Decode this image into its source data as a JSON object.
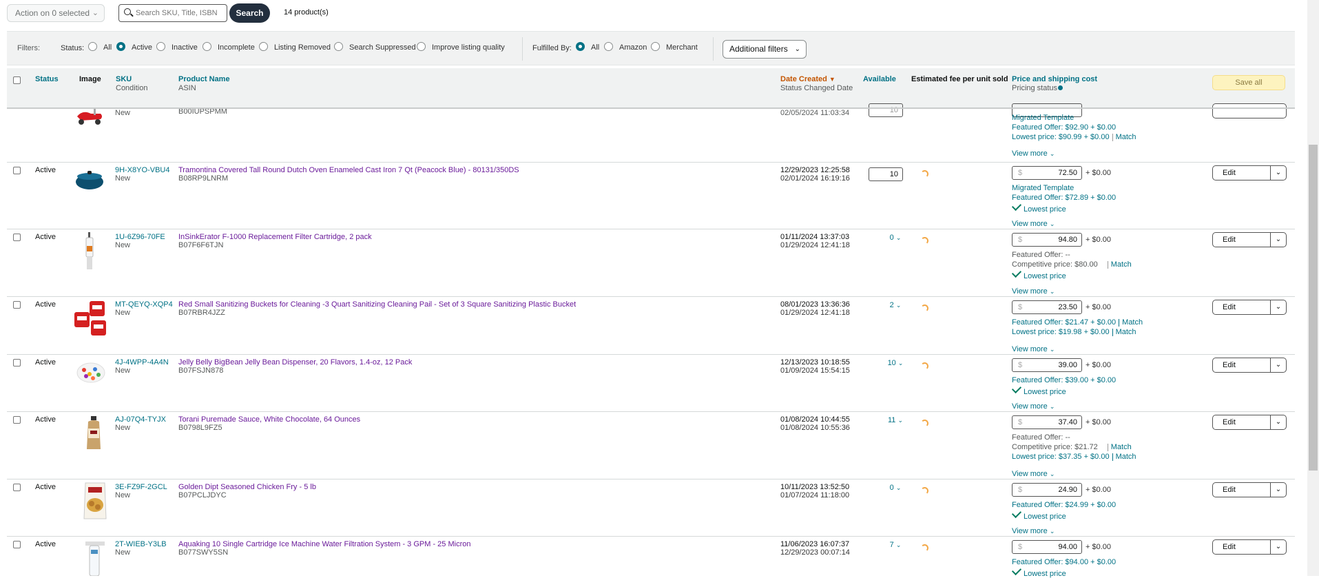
{
  "toolbar": {
    "action_label": "Action on 0 selected",
    "search_placeholder": "Search SKU, Title, ISBN",
    "search_label": "Search",
    "product_count": "14 product(s)"
  },
  "filters": {
    "label": "Filters:",
    "status_label": "Status:",
    "status_options": [
      "All",
      "Active",
      "Inactive",
      "Incomplete",
      "Listing Removed",
      "Search Suppressed",
      "Improve listing quality"
    ],
    "status_selected": "Active",
    "fulfilled_label": "Fulfilled By:",
    "fulfilled_options": [
      "All",
      "Amazon",
      "Merchant"
    ],
    "fulfilled_selected": "All",
    "additional_label": "Additional filters"
  },
  "header": {
    "status": "Status",
    "image": "Image",
    "sku": "SKU",
    "condition": "Condition",
    "product_name": "Product Name",
    "asin": "ASIN",
    "date_created": "Date Created",
    "status_changed": "Status Changed Date",
    "available": "Available",
    "fee": "Estimated fee per unit sold",
    "price": "Price and shipping cost",
    "pricing_status": "Pricing status",
    "save_all": "Save all"
  },
  "partial_row": {
    "condition": "New",
    "asin": "B00IUPSPMM",
    "changed": "02/05/2024 11:03:34",
    "available": "10",
    "price_lines": [
      "Migrated Template",
      "Featured Offer: $92.90 + $0.00",
      "Lowest price: $90.99 + $0.00"
    ],
    "match": "Match",
    "view_more": "View more"
  },
  "rows": [
    {
      "status": "Active",
      "sku": "9H-X8YO-VBU4",
      "condition": "New",
      "name": "Tramontina Covered Tall Round Dutch Oven Enameled Cast Iron 7 Qt (Peacock Blue) - 80131/350DS",
      "asin": "B08RP9LNRM",
      "created": "12/29/2023 12:25:58",
      "changed": "02/01/2024 16:19:16",
      "available": "10",
      "price": "72.50",
      "shipping": "+ $0.00",
      "currency": "$",
      "line1": "Migrated Template",
      "line2": "Featured Offer: $72.89 + $0.00",
      "line3": "Lowest price",
      "view_more": "View more",
      "edit": "Edit"
    },
    {
      "status": "Active",
      "sku": "1U-6Z96-70FE",
      "condition": "New",
      "name": "InSinkErator F-1000 Replacement Filter Cartridge, 2 pack",
      "asin": "B07F6F6TJN",
      "created": "01/11/2024 13:37:03",
      "changed": "01/29/2024 12:41:18",
      "available": "0",
      "price": "94.80",
      "shipping": "+ $0.00",
      "currency": "$",
      "line1": "Featured Offer: --",
      "line2": "Competitive price: $80.00",
      "match2": "Match",
      "line3": "Lowest price",
      "view_more": "View more",
      "edit": "Edit"
    },
    {
      "status": "Active",
      "sku": "MT-QEYQ-XQP4",
      "condition": "New",
      "name": "Red Small Sanitizing Buckets for Cleaning -3 Quart Sanitizing Cleaning Pail - Set of 3 Square Sanitizing Plastic Bucket",
      "asin": "B07RBR4JZZ",
      "created": "08/01/2023 13:36:36",
      "changed": "01/29/2024 12:41:18",
      "available": "2",
      "price": "23.50",
      "shipping": "+ $0.00",
      "currency": "$",
      "line1": "Featured Offer: $21.47 + $0.00",
      "match1": "Match",
      "line2": "Lowest price: $19.98 + $0.00",
      "match2": "Match",
      "view_more": "View more",
      "edit": "Edit"
    },
    {
      "status": "Active",
      "sku": "4J-4WPP-4A4N",
      "condition": "New",
      "name": "Jelly Belly BigBean Jelly Bean Dispenser, 20 Flavors, 1.4-oz, 12 Pack",
      "asin": "B07FSJN878",
      "created": "12/13/2023 10:18:55",
      "changed": "01/09/2024 15:54:15",
      "available": "10",
      "price": "39.00",
      "shipping": "+ $0.00",
      "currency": "$",
      "line1": "Featured Offer: $39.00 + $0.00",
      "line2": "Lowest price",
      "view_more": "View more",
      "edit": "Edit"
    },
    {
      "status": "Active",
      "sku": "AJ-07Q4-TYJX",
      "condition": "New",
      "name": "Torani Puremade Sauce, White Chocolate, 64 Ounces",
      "asin": "B0798L9FZ5",
      "created": "01/08/2024 10:44:55",
      "changed": "01/08/2024 10:55:36",
      "available": "11",
      "price": "37.40",
      "shipping": "+ $0.00",
      "currency": "$",
      "line1": "Featured Offer: --",
      "line2": "Competitive price: $21.72",
      "match2": "Match",
      "line3": "Lowest price: $37.35 + $0.00",
      "match3": "Match",
      "view_more": "View more",
      "edit": "Edit"
    },
    {
      "status": "Active",
      "sku": "3E-FZ9F-2GCL",
      "condition": "New",
      "name": "Golden Dipt Seasoned Chicken Fry - 5 lb",
      "asin": "B07PCLJDYC",
      "created": "10/11/2023 13:52:50",
      "changed": "01/07/2024 11:18:00",
      "available": "0",
      "price": "24.90",
      "shipping": "+ $0.00",
      "currency": "$",
      "line1": "Featured Offer: $24.99 + $0.00",
      "line2": "Lowest price",
      "view_more": "View more",
      "edit": "Edit"
    },
    {
      "status": "Active",
      "sku": "2T-WIEB-Y3LB",
      "condition": "New",
      "name": "Aquaking 10 Single Cartridge Ice Machine Water Filtration System - 3 GPM - 25 Micron",
      "asin": "B077SWY5SN",
      "created": "11/06/2023 16:07:37",
      "changed": "12/29/2023 00:07:14",
      "available": "7",
      "price": "94.00",
      "shipping": "+ $0.00",
      "currency": "$",
      "line1": "Featured Offer: $94.00 + $0.00",
      "line2": "Lowest price",
      "edit": "Edit"
    }
  ]
}
